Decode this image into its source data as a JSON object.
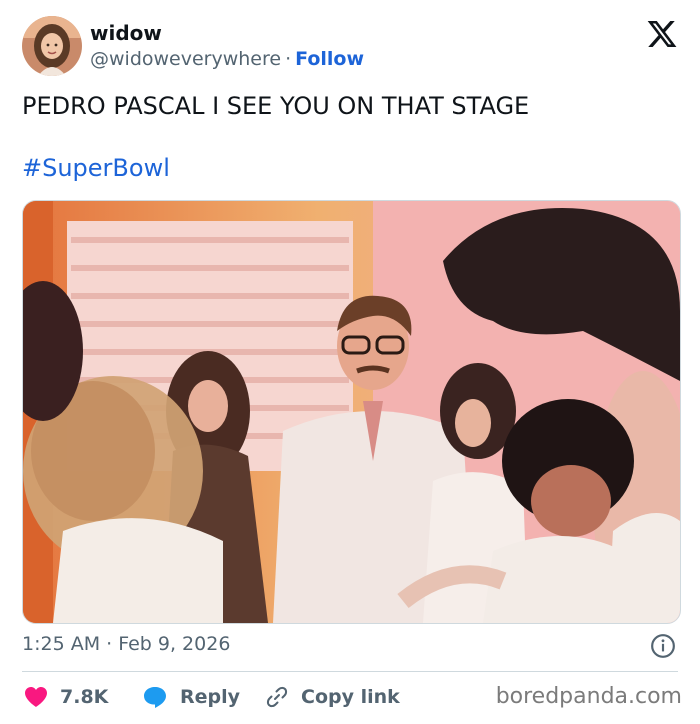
{
  "tweet": {
    "author_name": "widow",
    "author_handle": "@widoweverywhere",
    "separator": "·",
    "follow_label": "Follow",
    "text": "PEDRO PASCAL I SEE YOU ON THAT STAGE",
    "hashtag": "#SuperBowl",
    "timestamp": "1:25 AM · Feb 9, 2026"
  },
  "actions": {
    "likes_count": "7.8K",
    "reply_label": "Reply",
    "copy_link_label": "Copy link"
  },
  "watermark": "boredpanda.com",
  "icons": {
    "brand": "x-logo-icon",
    "like": "heart-icon",
    "reply": "speech-bubble-icon",
    "copy": "link-icon",
    "info": "info-icon"
  },
  "colors": {
    "link_blue": "#1d64d8",
    "like_red": "#f91880",
    "reply_blue": "#1d9bf0",
    "muted_text": "#536471"
  }
}
